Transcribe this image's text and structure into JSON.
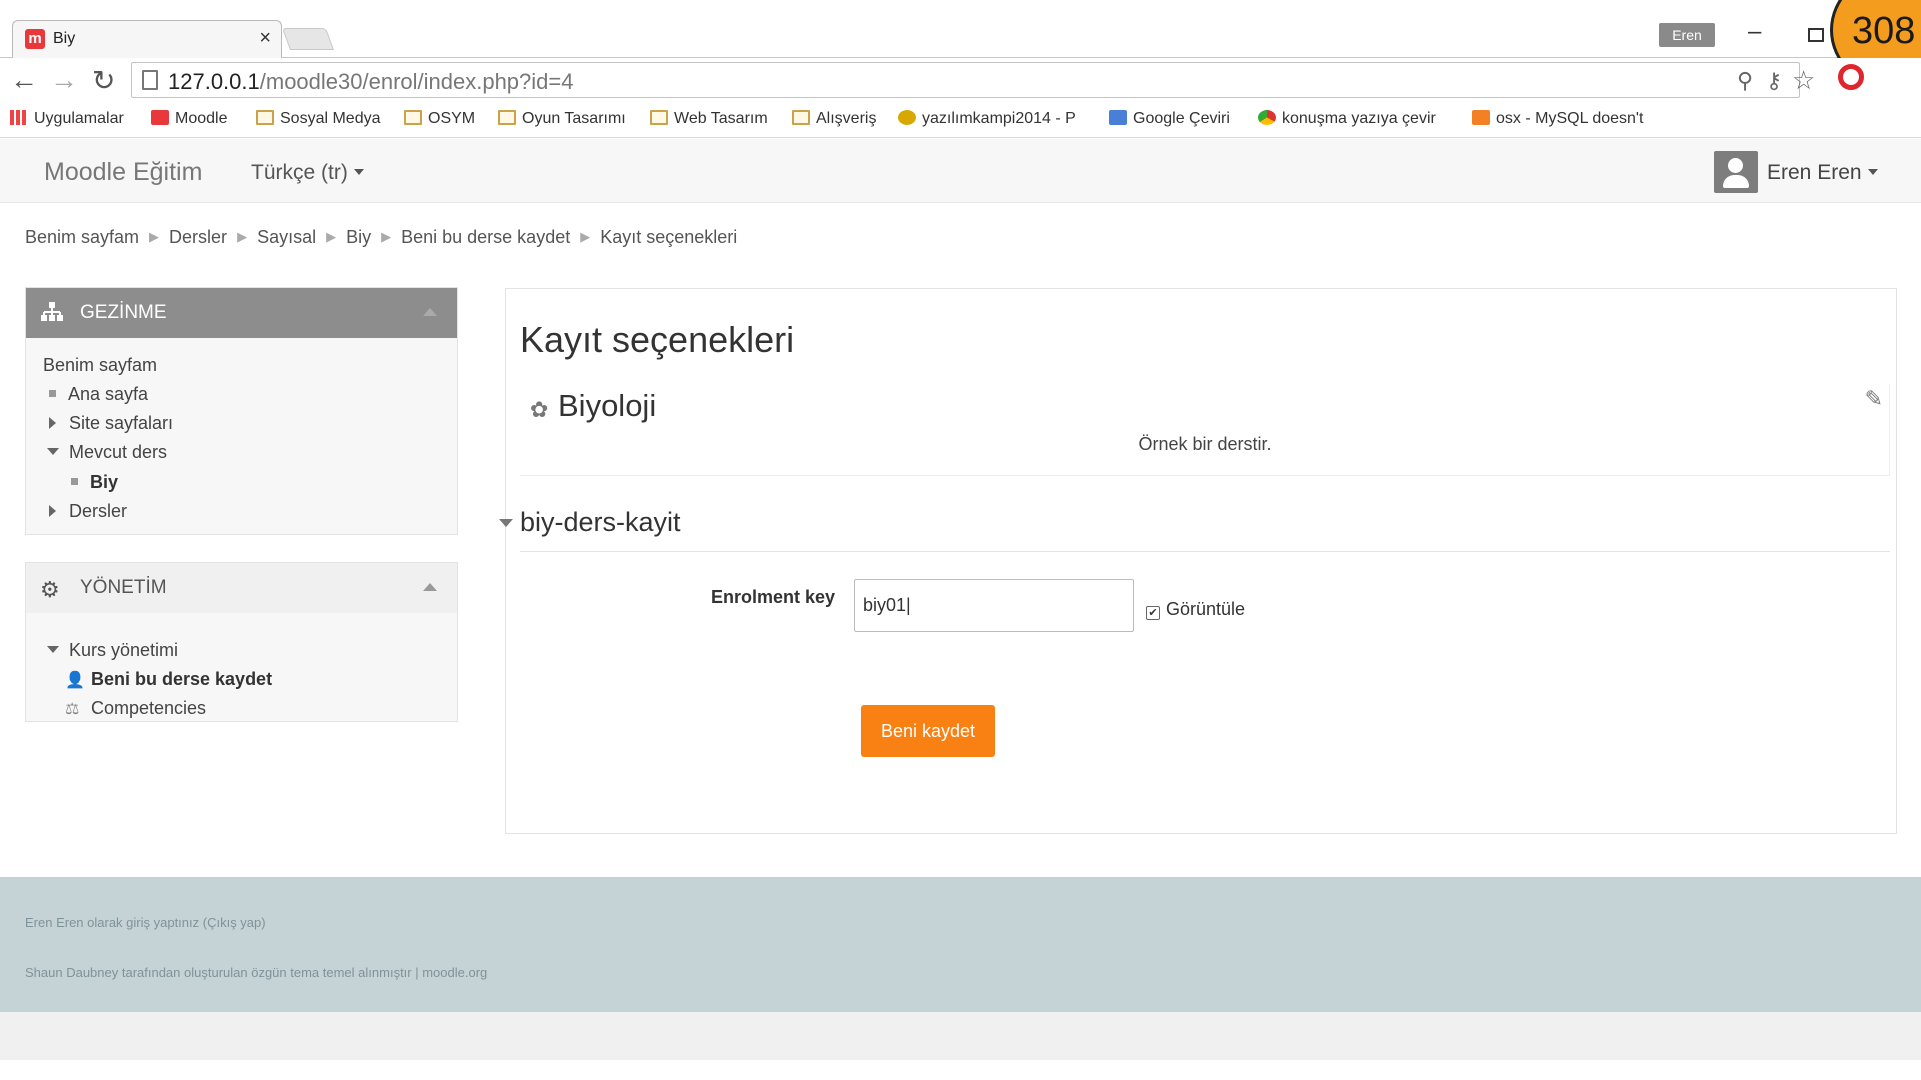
{
  "browser": {
    "tab_title": "Biy",
    "tab_close": "×",
    "profile_name": "Eren",
    "minimize": "–",
    "corner_number": "308",
    "url_host": "127.0.0.1",
    "url_path": "/moodle30/enrol/index.php?id=4",
    "back": "←",
    "forward": "→",
    "reload": "↻",
    "zoom_icon": "⚲",
    "key_icon": "⚷",
    "star_icon": "☆"
  },
  "bookmarks": [
    {
      "label": "Uygulamalar",
      "icon": "apps-icon"
    },
    {
      "label": "Moodle",
      "icon": "moodle-icon"
    },
    {
      "label": "Sosyal Medya",
      "icon": "folder-icon"
    },
    {
      "label": "OSYM",
      "icon": "folder-icon"
    },
    {
      "label": "Oyun Tasarımı",
      "icon": "folder-icon"
    },
    {
      "label": "Web Tasarım",
      "icon": "folder-icon"
    },
    {
      "label": "Alışveriş",
      "icon": "folder-icon"
    },
    {
      "label": "yazılımkampi2014 - P",
      "icon": "site-icon"
    },
    {
      "label": "Google Çeviri",
      "icon": "translate-icon"
    },
    {
      "label": "konuşma yazıya çevir",
      "icon": "chrome-icon"
    },
    {
      "label": "osx - MySQL doesn't",
      "icon": "stackoverflow-icon"
    }
  ],
  "navbar": {
    "site_name": "Moodle Eğitim",
    "language": "Türkçe (tr)",
    "user_name": "Eren Eren"
  },
  "breadcrumb": [
    "Benim sayfam",
    "Dersler",
    "Sayısal",
    "Biy",
    "Beni bu derse kaydet",
    "Kayıt seçenekleri"
  ],
  "breadcrumb_separator": "▶",
  "nav_block": {
    "title": "GEZİNME",
    "items": [
      "Benim sayfam",
      "Ana sayfa",
      "Site sayfaları",
      "Mevcut ders",
      "Biy",
      "Dersler"
    ]
  },
  "admin_block": {
    "title": "YÖNETİM",
    "items": [
      "Kurs yönetimi",
      "Beni bu derse kaydet",
      "Competencies"
    ]
  },
  "main": {
    "page_title": "Kayıt seçenekleri",
    "course_name": "Biyoloji",
    "course_summary": "Örnek bir derstir.",
    "section_title": "biy-ders-kayit",
    "enrolment_label": "Enrolment key",
    "enrolment_value": "biy01|",
    "show_label": "Görüntüle",
    "show_checked_mark": "✔",
    "submit_label": "Beni kaydet"
  },
  "footer": {
    "login_info": "Eren Eren olarak giriş yaptınız (Çıkış yap)",
    "theme_credit": "Shaun Daubney tarafından oluşturulan özgün tema temel alınmıştır | moodle.org"
  },
  "colors": {
    "accent": "#f98012",
    "nav_header": "#8d8d8d",
    "footer": "#c5d2d6"
  }
}
